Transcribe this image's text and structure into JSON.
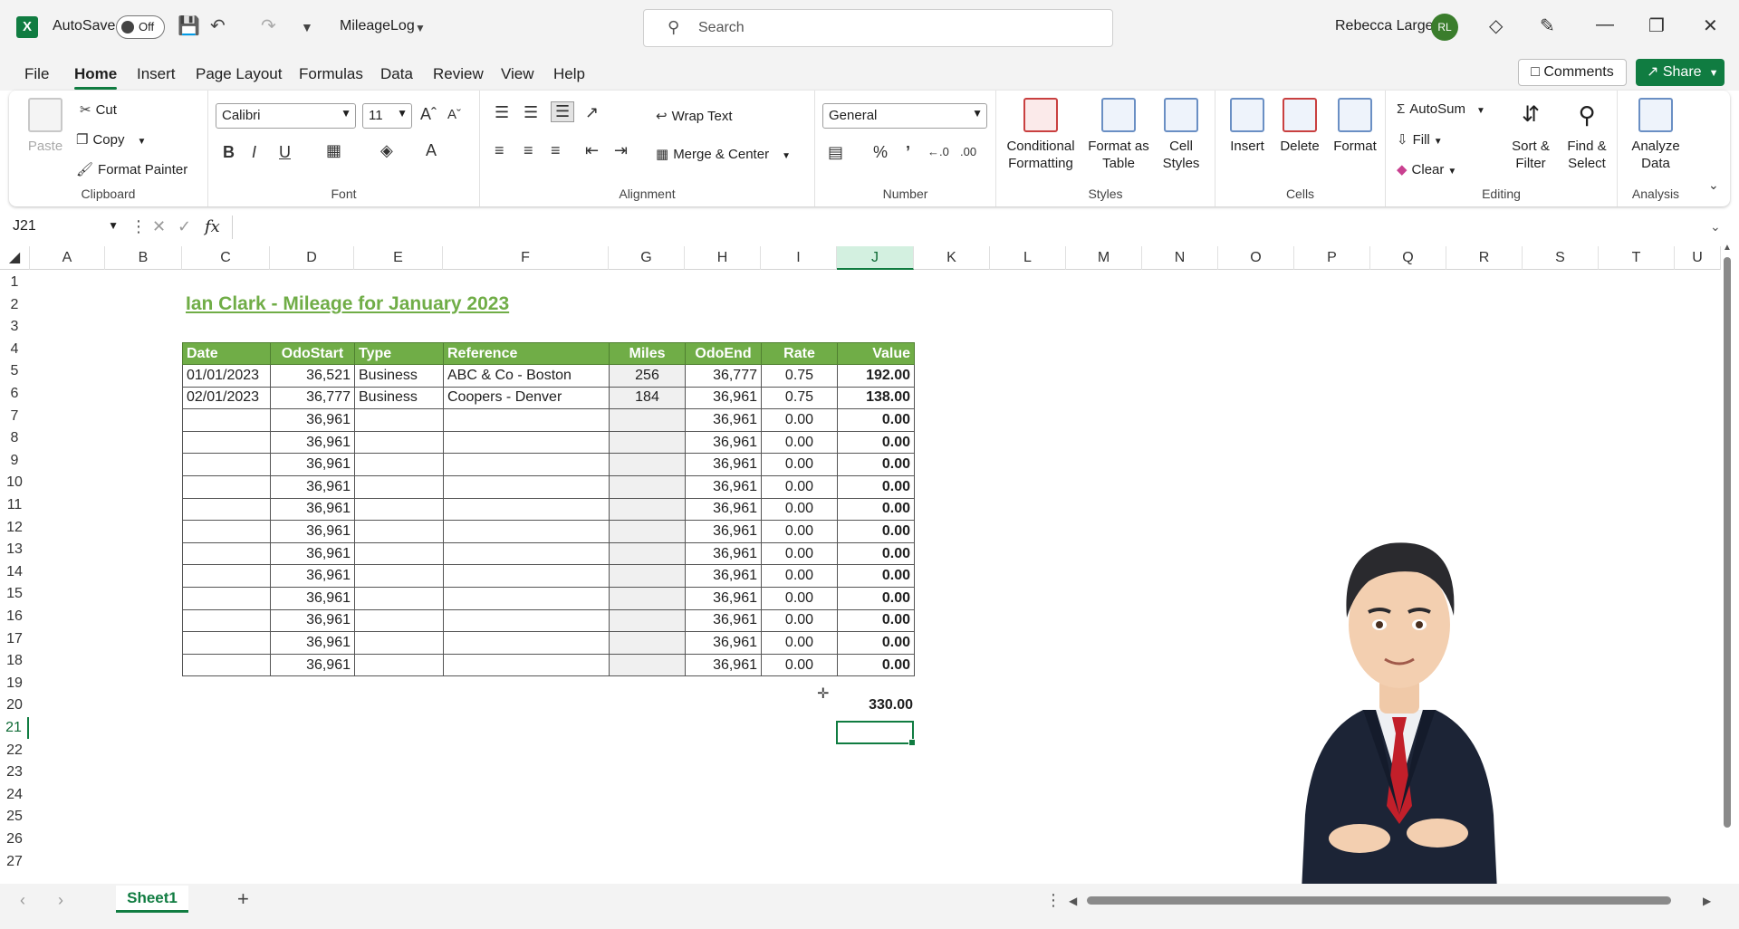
{
  "app": {
    "autosave_label": "AutoSave",
    "autosave_state": "Off",
    "filename": "MileageLog",
    "search_placeholder": "Search",
    "user_name": "Rebecca Large",
    "user_initials": "RL"
  },
  "menu": {
    "tabs": [
      "File",
      "Home",
      "Insert",
      "Page Layout",
      "Formulas",
      "Data",
      "Review",
      "View",
      "Help"
    ],
    "active": "Home",
    "comments": "Comments",
    "share": "Share"
  },
  "ribbon": {
    "clipboard": {
      "name": "Clipboard",
      "paste": "Paste",
      "cut": "Cut",
      "copy": "Copy",
      "format_painter": "Format Painter"
    },
    "font": {
      "name": "Font",
      "family": "Calibri",
      "size": "11"
    },
    "alignment": {
      "name": "Alignment",
      "wrap": "Wrap Text",
      "merge": "Merge & Center"
    },
    "number": {
      "name": "Number",
      "format": "General"
    },
    "styles": {
      "name": "Styles",
      "conditional_1": "Conditional",
      "conditional_2": "Formatting",
      "table_1": "Format as",
      "table_2": "Table",
      "cell_1": "Cell",
      "cell_2": "Styles"
    },
    "cells": {
      "name": "Cells",
      "insert": "Insert",
      "delete": "Delete",
      "format": "Format"
    },
    "editing": {
      "name": "Editing",
      "autosum": "AutoSum",
      "fill": "Fill",
      "clear": "Clear",
      "sort_1": "Sort &",
      "sort_2": "Filter",
      "find_1": "Find &",
      "find_2": "Select"
    },
    "analysis": {
      "name": "Analysis",
      "analyze_1": "Analyze",
      "analyze_2": "Data"
    }
  },
  "formula_bar": {
    "name_box": "J21",
    "fx": "fx",
    "formula": ""
  },
  "columns": [
    "A",
    "B",
    "C",
    "D",
    "E",
    "F",
    "G",
    "H",
    "I",
    "J",
    "K",
    "L",
    "M",
    "N",
    "O",
    "P",
    "Q",
    "R",
    "S",
    "T",
    "U"
  ],
  "selected_column": "J",
  "selected_row": "21",
  "rows": [
    "1",
    "2",
    "3",
    "4",
    "5",
    "6",
    "7",
    "8",
    "9",
    "10",
    "11",
    "12",
    "13",
    "14",
    "15",
    "16",
    "17",
    "18",
    "19",
    "20",
    "21",
    "22",
    "23",
    "24",
    "25",
    "26",
    "27"
  ],
  "sheet": {
    "title": "Ian Clark - Mileage for January 2023",
    "headers": [
      "Date",
      "OdoStart",
      "Type",
      "Reference",
      "Miles",
      "OdoEnd",
      "Rate",
      "Value"
    ],
    "rows": [
      [
        "01/01/2023",
        "36,521",
        "Business",
        "ABC & Co - Boston",
        "256",
        "36,777",
        "0.75",
        "192.00"
      ],
      [
        "02/01/2023",
        "36,777",
        "Business",
        "Coopers - Denver",
        "184",
        "36,961",
        "0.75",
        "138.00"
      ],
      [
        "",
        "36,961",
        "",
        "",
        "",
        "36,961",
        "0.00",
        "0.00"
      ],
      [
        "",
        "36,961",
        "",
        "",
        "",
        "36,961",
        "0.00",
        "0.00"
      ],
      [
        "",
        "36,961",
        "",
        "",
        "",
        "36,961",
        "0.00",
        "0.00"
      ],
      [
        "",
        "36,961",
        "",
        "",
        "",
        "36,961",
        "0.00",
        "0.00"
      ],
      [
        "",
        "36,961",
        "",
        "",
        "",
        "36,961",
        "0.00",
        "0.00"
      ],
      [
        "",
        "36,961",
        "",
        "",
        "",
        "36,961",
        "0.00",
        "0.00"
      ],
      [
        "",
        "36,961",
        "",
        "",
        "",
        "36,961",
        "0.00",
        "0.00"
      ],
      [
        "",
        "36,961",
        "",
        "",
        "",
        "36,961",
        "0.00",
        "0.00"
      ],
      [
        "",
        "36,961",
        "",
        "",
        "",
        "36,961",
        "0.00",
        "0.00"
      ],
      [
        "",
        "36,961",
        "",
        "",
        "",
        "36,961",
        "0.00",
        "0.00"
      ],
      [
        "",
        "36,961",
        "",
        "",
        "",
        "36,961",
        "0.00",
        "0.00"
      ],
      [
        "",
        "36,961",
        "",
        "",
        "",
        "36,961",
        "0.00",
        "0.00"
      ]
    ],
    "total": "330.00"
  },
  "sheet_tabs": {
    "active": "Sheet1"
  },
  "colors": {
    "excel_green": "#107c41",
    "header_green": "#70ad47"
  }
}
